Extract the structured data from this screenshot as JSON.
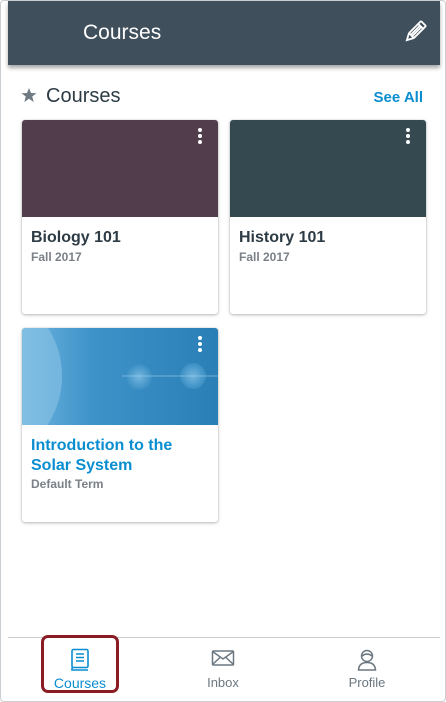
{
  "app_bar": {
    "title": "Courses"
  },
  "section": {
    "title": "Courses",
    "see_all": "See All"
  },
  "courses": [
    {
      "name": "Biology 101",
      "term": "Fall 2017",
      "color": "#523d4c"
    },
    {
      "name": "History 101",
      "term": "Fall 2017",
      "color": "#344a50"
    },
    {
      "name": "Introduction to the Solar System",
      "term": "Default Term",
      "color": "#2f86c0"
    }
  ],
  "tabs": [
    {
      "label": "Courses",
      "active": true
    },
    {
      "label": "Inbox",
      "active": false
    },
    {
      "label": "Profile",
      "active": false
    }
  ],
  "colors": {
    "accent": "#0a8ed0",
    "appbar": "#3f4f5b",
    "highlight": "#8b1c24"
  }
}
